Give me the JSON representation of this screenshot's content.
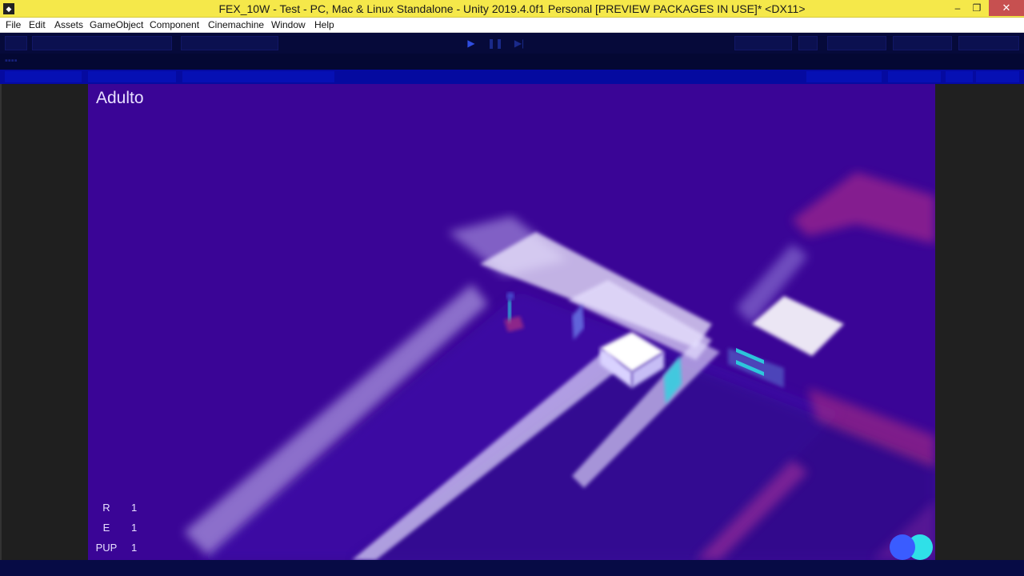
{
  "window": {
    "title": "FEX_10W - Test - PC, Mac & Linux Standalone - Unity 2019.4.0f1 Personal [PREVIEW PACKAGES IN USE]* <DX11>",
    "app_icon": "unity-icon",
    "minimize": "–",
    "maximize": "❐",
    "close": "✕"
  },
  "menu": {
    "items": [
      "File",
      "Edit",
      "Assets",
      "GameObject",
      "Component",
      "Cinemachine",
      "Window",
      "Help"
    ]
  },
  "toolbar": {
    "play_icon": "▶",
    "pause_icon": "❚❚",
    "step_icon": "▶|"
  },
  "game": {
    "mode_label": "Adulto",
    "stats": [
      {
        "key": "R",
        "value": "1"
      },
      {
        "key": "E",
        "value": "1"
      },
      {
        "key": "PUP",
        "value": "1"
      }
    ],
    "colors": {
      "background": "#3a0596",
      "wall": "#e8e0ff",
      "accent_pink": "#d62a7a",
      "accent_cyan": "#2ad6e0",
      "orb_blue": "#3a5cff",
      "orb_cyan": "#2fe0e8"
    }
  }
}
